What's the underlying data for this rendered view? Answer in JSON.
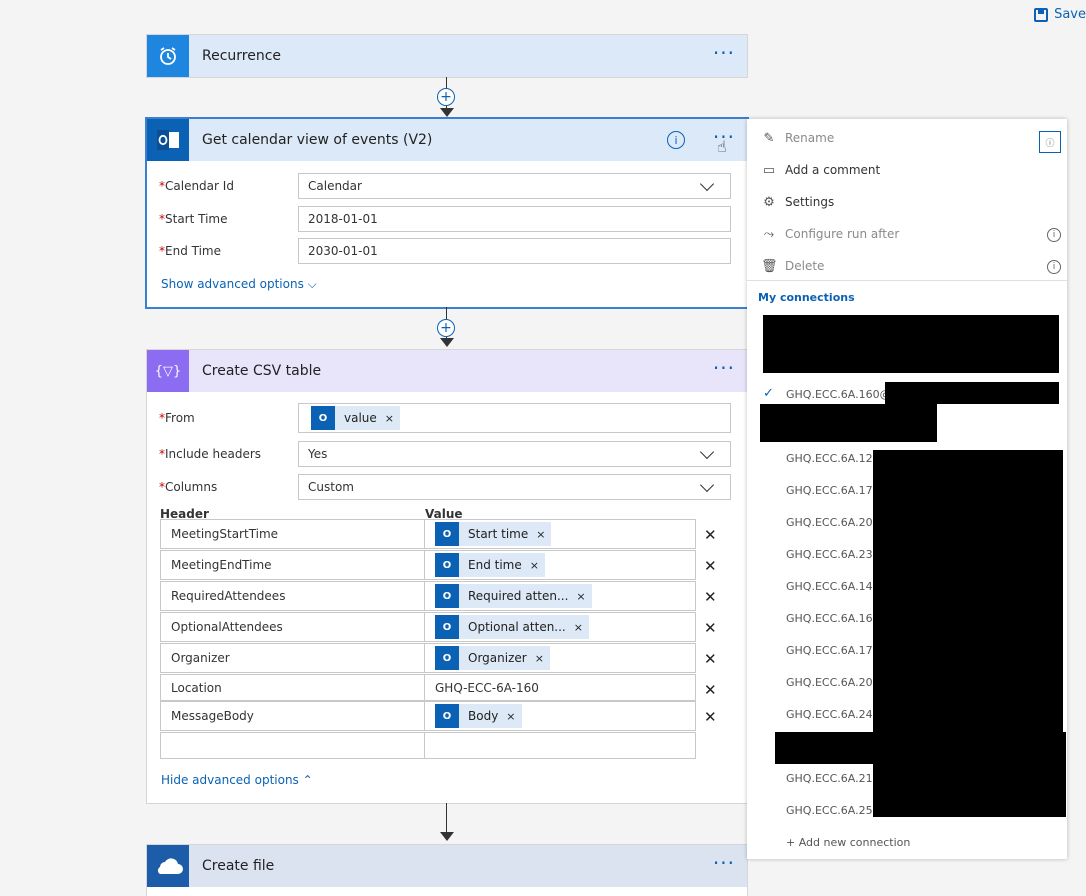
{
  "toolbar": {
    "save_label": "Save"
  },
  "recurrence": {
    "title": "Recurrence",
    "more": "···"
  },
  "calendar": {
    "title": "Get calendar view of events (V2)",
    "more": "···",
    "fields": [
      {
        "label": "Calendar Id",
        "value": "Calendar"
      },
      {
        "label": "Start Time",
        "value": "2018-01-01"
      },
      {
        "label": "End Time",
        "value": "2030-01-01"
      }
    ],
    "show_advanced": "Show advanced options"
  },
  "csv": {
    "title": "Create CSV table",
    "more": "···",
    "from_label": "From",
    "from_token": "value",
    "include_headers_label": "Include headers",
    "include_headers_value": "Yes",
    "columns_label": "Columns",
    "columns_value": "Custom",
    "header_col": "Header",
    "value_col": "Value",
    "rows": [
      {
        "header": "MeetingStartTime",
        "value": "Start time",
        "token": true
      },
      {
        "header": "MeetingEndTime",
        "value": "End time",
        "token": true
      },
      {
        "header": "RequiredAttendees",
        "value": "Required atten...",
        "token": true
      },
      {
        "header": "OptionalAttendees",
        "value": "Optional atten...",
        "token": true
      },
      {
        "header": "Organizer",
        "value": "Organizer",
        "token": true
      },
      {
        "header": "Location",
        "value": "GHQ-ECC-6A-160",
        "token": false
      },
      {
        "header": "MessageBody",
        "value": "Body",
        "token": true
      }
    ],
    "hide_advanced": "Hide advanced options"
  },
  "createfile": {
    "title": "Create file",
    "more": "···"
  },
  "menu": {
    "rename": "Rename",
    "add_comment": "Add a comment",
    "settings": "Settings",
    "configure_run_after": "Configure run after",
    "delete": "Delete",
    "my_connections": "My connections",
    "connections": [
      "GHQ.ECC.6A.160@",
      "GHQ.ECC.6A.122",
      "GHQ.ECC.6A.172",
      "GHQ.ECC.6A.201",
      "GHQ.ECC.6A.230",
      "GHQ.ECC.6A.142",
      "GHQ.ECC.6A.162",
      "GHQ.ECC.6A.170",
      "GHQ.ECC.6A.204",
      "GHQ.ECC.6A.240",
      "GHQ.ECC.6A.210",
      "GHQ.ECC.6A.250"
    ],
    "add_connection": "+ Add new connection"
  },
  "colors": {
    "accent": "#0b62b4",
    "recurrence_head": "#dce9f8",
    "calendar_head": "#dce9f8",
    "csv_head": "#e8e4fa",
    "csv_icon": "#8c6cf0",
    "file_head": "#dce3f0",
    "file_icon": "#1c5ca8"
  }
}
